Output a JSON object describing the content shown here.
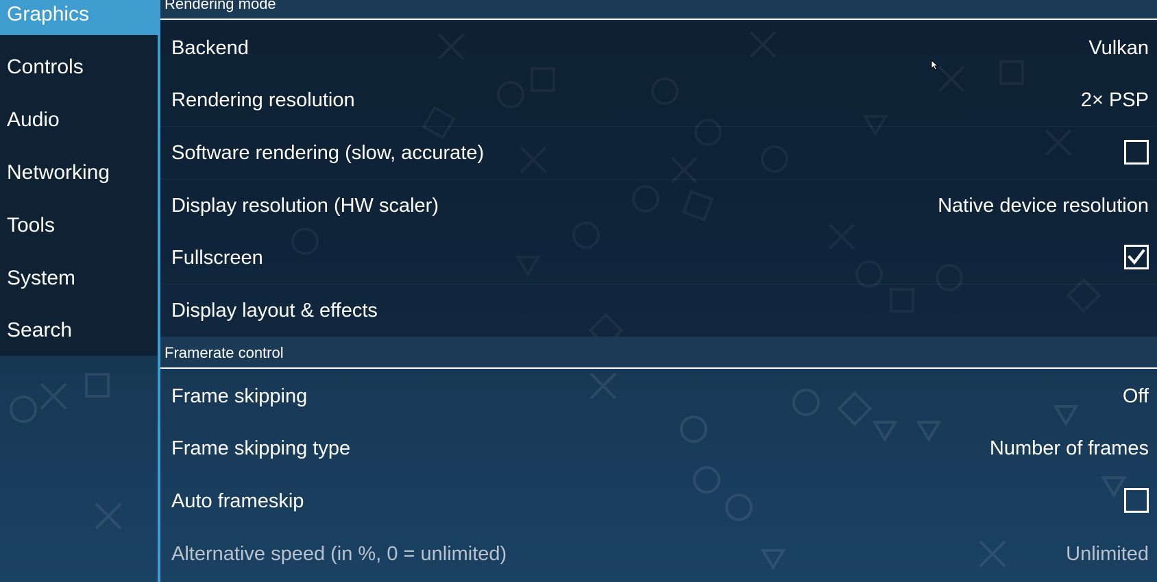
{
  "sidebar": {
    "tabs": [
      {
        "label": "Graphics",
        "active": true
      },
      {
        "label": "Controls"
      },
      {
        "label": "Audio"
      },
      {
        "label": "Networking"
      },
      {
        "label": "Tools"
      },
      {
        "label": "System"
      },
      {
        "label": "Search"
      }
    ]
  },
  "sections": [
    {
      "title": "Rendering mode",
      "items": [
        {
          "label": "Backend",
          "value": "Vulkan"
        },
        {
          "label": "Rendering resolution",
          "value": "2× PSP"
        },
        {
          "label": "Software rendering (slow, accurate)",
          "checkbox": false
        },
        {
          "label": "Display resolution (HW scaler)",
          "value": "Native device resolution"
        },
        {
          "label": "Fullscreen",
          "checkbox": true
        },
        {
          "label": "Display layout & effects"
        }
      ]
    },
    {
      "title": "Framerate control",
      "items": [
        {
          "label": "Frame skipping",
          "value": "Off"
        },
        {
          "label": "Frame skipping type",
          "value": "Number of frames"
        },
        {
          "label": "Auto frameskip",
          "checkbox": false
        },
        {
          "label": "Alternative speed (in %, 0 = unlimited)",
          "value": "Unlimited",
          "disabled": true
        }
      ]
    }
  ],
  "colors": {
    "accent": "#3e9ccf",
    "sidebar_bg": "#0f2233",
    "text": "#ffffff",
    "disabled_text": "#b9c3cd"
  },
  "icons": {
    "checkbox_checked": "checkmark-icon",
    "cursor": "mouse-pointer-icon"
  }
}
